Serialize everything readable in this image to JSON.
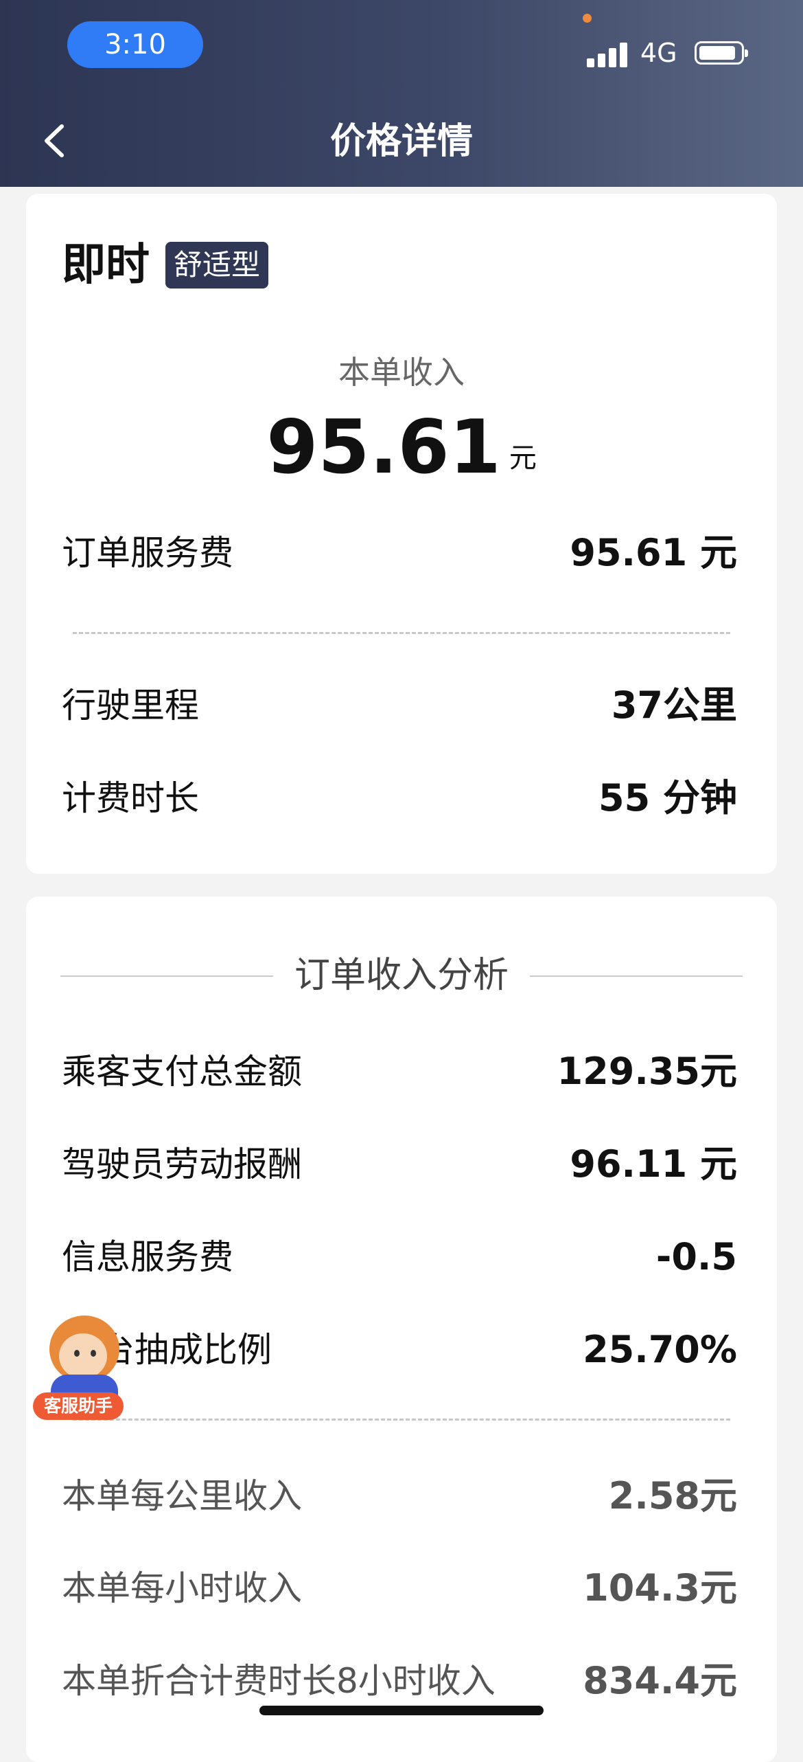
{
  "status_bar": {
    "time": "3:10",
    "network": "4G",
    "icons": [
      "signal-icon",
      "battery-icon"
    ]
  },
  "header": {
    "title": "价格详情",
    "back_icon": "chevron-left-icon"
  },
  "order_card": {
    "type": "即时",
    "badge": "舒适型",
    "income_label": "本单收入",
    "income_value": "95.61",
    "income_unit": "元",
    "rows": [
      {
        "label": "订单服务费",
        "value": "95.61 元"
      },
      {
        "label": "行驶里程",
        "value": "37公里"
      },
      {
        "label": "计费时长",
        "value": "55 分钟"
      }
    ]
  },
  "analysis_card": {
    "title": "订单收入分析",
    "rows": [
      {
        "label": "乘客支付总金额",
        "value": "129.35元"
      },
      {
        "label": "驾驶员劳动报酬",
        "value": "96.11 元"
      },
      {
        "label": "信息服务费",
        "value": "-0.5"
      },
      {
        "label": "台抽成比例",
        "value": "25.70%"
      }
    ],
    "stats": [
      {
        "label": "本单每公里收入",
        "value": "2.58元"
      },
      {
        "label": "本单每小时收入",
        "value": "104.3元"
      },
      {
        "label": "本单折合计费时长8小时收入",
        "value": "834.4元"
      }
    ]
  },
  "assistant": {
    "label": "客服助手"
  },
  "colors": {
    "header_start": "#2d3553",
    "header_end": "#5a6784",
    "badge": "#2f3755",
    "time_pill": "#2f7cf6",
    "assistant_tag": "#ee5a33"
  }
}
